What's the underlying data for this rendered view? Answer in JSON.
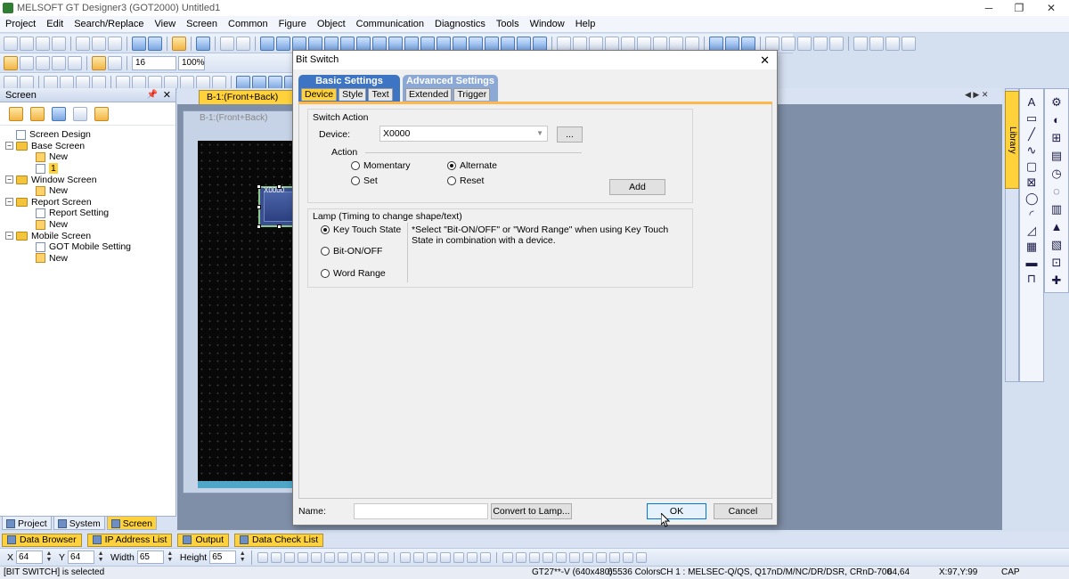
{
  "window": {
    "title": "MELSOFT GT Designer3 (GOT2000) Untitled1",
    "min_glyph": "─",
    "restore_glyph": "❐",
    "close_glyph": "✕"
  },
  "menu": [
    "Project",
    "Edit",
    "Search/Replace",
    "View",
    "Screen",
    "Common",
    "Figure",
    "Object",
    "Communication",
    "Diagnostics",
    "Tools",
    "Window",
    "Help"
  ],
  "toolbar": {
    "font_size": "16",
    "zoom": "100%"
  },
  "screen_panel": {
    "title": "Screen",
    "pin_glyph": "📌",
    "close_glyph": "✕",
    "tree": [
      {
        "label": "Screen Design",
        "indent": 0,
        "kind": "doc",
        "toggle": ""
      },
      {
        "label": "Base Screen",
        "indent": 0,
        "kind": "folder",
        "toggle": "−"
      },
      {
        "label": "New",
        "indent": 1,
        "kind": "new",
        "toggle": ""
      },
      {
        "label": "1",
        "indent": 1,
        "kind": "doc",
        "toggle": "",
        "selected": true
      },
      {
        "label": "Window Screen",
        "indent": 0,
        "kind": "folder",
        "toggle": "−"
      },
      {
        "label": "New",
        "indent": 1,
        "kind": "new",
        "toggle": ""
      },
      {
        "label": "Report Screen",
        "indent": 0,
        "kind": "folder",
        "toggle": "−"
      },
      {
        "label": "Report Setting",
        "indent": 1,
        "kind": "doc",
        "toggle": ""
      },
      {
        "label": "New",
        "indent": 1,
        "kind": "new",
        "toggle": ""
      },
      {
        "label": "Mobile Screen",
        "indent": 0,
        "kind": "folder",
        "toggle": "−"
      },
      {
        "label": "GOT Mobile Setting",
        "indent": 1,
        "kind": "doc",
        "toggle": ""
      },
      {
        "label": "New",
        "indent": 1,
        "kind": "new",
        "toggle": ""
      }
    ],
    "tabs": [
      "Project",
      "System",
      "Screen"
    ]
  },
  "editor": {
    "tab_label": "B-1:(Front+Back)",
    "tab_close": "✕",
    "window_caption": "B-1:(Front+Back)",
    "object_label": "X0000",
    "scroll_glyphs": "◀ ▶ ✕"
  },
  "library_tab": "Library",
  "right_tools": [
    "A",
    "▭",
    "╱",
    "∿",
    "▢",
    "⊠",
    "◯",
    "◜",
    "◿",
    "▦",
    "▬",
    "⊓"
  ],
  "right_tools2": [
    "⚙",
    "◐",
    "⊞",
    "▤",
    "◷",
    "◌",
    "▥",
    "▲",
    "▧",
    "⊡",
    "✚"
  ],
  "bottom_tabs": [
    "Data Browser",
    "IP Address List",
    "Output",
    "Data Check List"
  ],
  "propbar": {
    "x_label": "X",
    "x_value": "64",
    "y_label": "Y",
    "y_value": "64",
    "w_label": "Width",
    "w_value": "65",
    "h_label": "Height",
    "h_value": "65"
  },
  "statusbar": {
    "selection": "[BIT SWITCH] is selected",
    "model": "GT27**-V (640x480)",
    "colors": "65536 Colors",
    "channel": "CH 1 : MELSEC-Q/QS, Q17nD/M/NC/DR/DSR, CRnD-700",
    "position": "64,64",
    "cursor": "X:97,Y:99",
    "caps": "CAP"
  },
  "dialog": {
    "title": "Bit Switch",
    "close_glyph": "✕",
    "group_basic": "Basic Settings",
    "group_advanced": "Advanced Settings",
    "basic_tabs": [
      "Device",
      "Style",
      "Text"
    ],
    "advanced_tabs": [
      "Extended",
      "Trigger"
    ],
    "switch_action_label": "Switch Action",
    "device_label": "Device:",
    "device_value": "X0000",
    "browse_label": "...",
    "action_label": "Action",
    "actions": [
      {
        "label": "Momentary",
        "checked": false
      },
      {
        "label": "Alternate",
        "checked": true
      },
      {
        "label": "Set",
        "checked": false
      },
      {
        "label": "Reset",
        "checked": false
      }
    ],
    "add_label": "Add",
    "lamp_label": "Lamp (Timing to change shape/text)",
    "lamp_options": [
      {
        "label": "Key Touch State",
        "checked": true
      },
      {
        "label": "Bit-ON/OFF",
        "checked": false
      },
      {
        "label": "Word Range",
        "checked": false
      }
    ],
    "lamp_note": "*Select \"Bit-ON/OFF\" or \"Word Range\" when using Key Touch State in combination with a device.",
    "name_label": "Name:",
    "name_value": "",
    "convert_label": "Convert to Lamp...",
    "ok_label": "OK",
    "cancel_label": "Cancel"
  }
}
